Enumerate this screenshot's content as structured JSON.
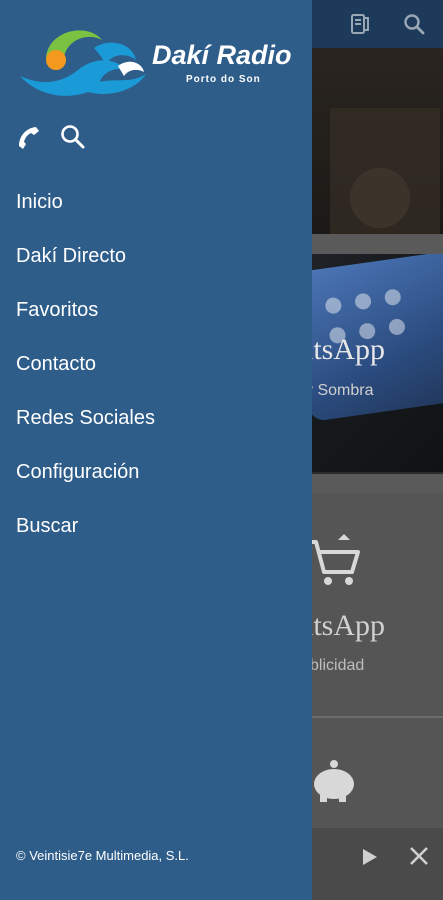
{
  "background": {
    "card2": {
      "title": "atsApp",
      "subtitle": "y Sombra"
    },
    "card3": {
      "title": "atsApp",
      "subtitle": "blicidad"
    }
  },
  "drawer": {
    "logo": {
      "name": "Dakí Radio",
      "tagline": "Porto do Son"
    },
    "quick_icons": [
      "phone-icon",
      "search-icon"
    ],
    "menu": [
      {
        "label": "Inicio"
      },
      {
        "label": "Dakí Directo"
      },
      {
        "label": "Favoritos"
      },
      {
        "label": "Contacto"
      },
      {
        "label": "Redes Sociales"
      },
      {
        "label": "Configuración"
      },
      {
        "label": "Buscar"
      }
    ],
    "footer": "© Veintisie7e Multimedia, S.L."
  },
  "colors": {
    "drawer": "#2e5d8a",
    "topbar": "#1d3a5a",
    "logo_blue": "#1a9ad6",
    "logo_green": "#7cc242",
    "logo_orange": "#f39a1e"
  }
}
